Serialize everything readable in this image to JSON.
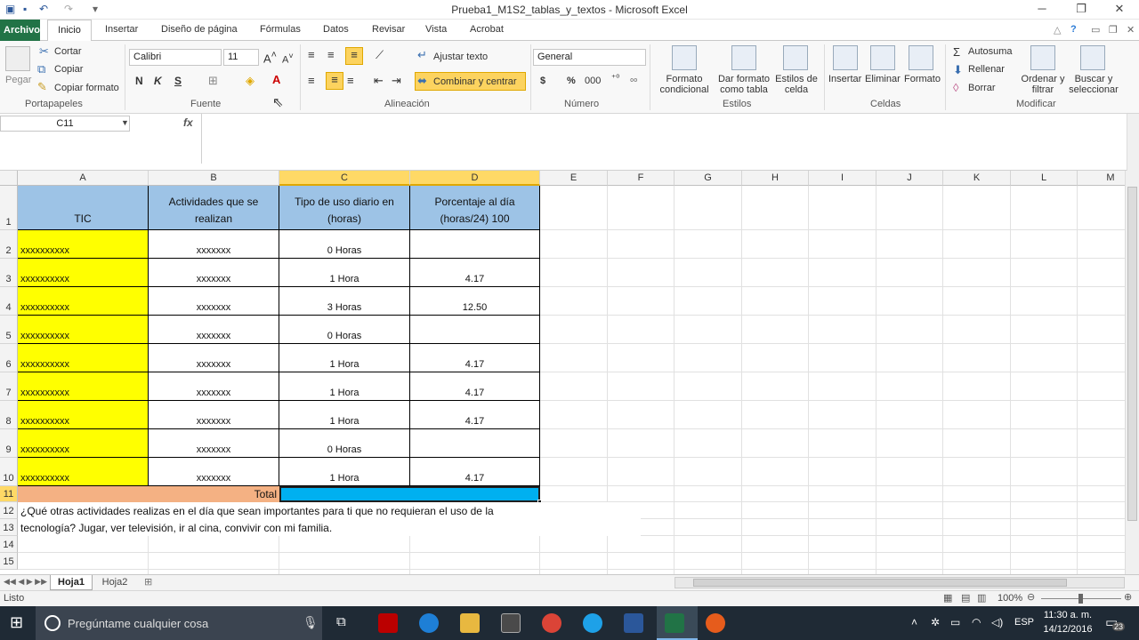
{
  "window": {
    "title": "Prueba1_M1S2_tablas_y_textos  -  Microsoft Excel"
  },
  "ribbon_tabs": [
    "Archivo",
    "Inicio",
    "Insertar",
    "Diseño de página",
    "Fórmulas",
    "Datos",
    "Revisar",
    "Vista",
    "Acrobat"
  ],
  "clipboard": {
    "paste": "Pegar",
    "cut": "Cortar",
    "copy": "Copiar",
    "format_painter": "Copiar formato",
    "label": "Portapapeles"
  },
  "font": {
    "name": "Calibri",
    "size": "11",
    "bold": "N",
    "italic": "K",
    "underline": "S",
    "label": "Fuente"
  },
  "alignment": {
    "wrap": "Ajustar texto",
    "merge": "Combinar y centrar",
    "label": "Alineación"
  },
  "number": {
    "format": "General",
    "currency": "$",
    "percent": "%",
    "thousands": "000",
    "label": "Número"
  },
  "styles": {
    "cond_format": "Formato condicional",
    "format_table": "Dar formato como tabla",
    "cell_styles": "Estilos de celda",
    "label": "Estilos"
  },
  "cells": {
    "insert": "Insertar",
    "delete": "Eliminar",
    "format": "Formato",
    "label": "Celdas"
  },
  "editing": {
    "autosum": "Autosuma",
    "fill": "Rellenar",
    "clear": "Borrar",
    "sort": "Ordenar y filtrar",
    "find": "Buscar y seleccionar",
    "label": "Modificar"
  },
  "formula_bar": {
    "name_box": "C11",
    "fx": "fx",
    "formula": ""
  },
  "columns": [
    "A",
    "B",
    "C",
    "D",
    "E",
    "F",
    "G",
    "H",
    "I",
    "J",
    "K",
    "L",
    "M"
  ],
  "rows": [
    "1",
    "2",
    "3",
    "4",
    "5",
    "6",
    "7",
    "8",
    "9",
    "10",
    "11",
    "12",
    "13",
    "14",
    "15"
  ],
  "table": {
    "headers": [
      "TIC",
      "Actividades que se realizan",
      "Tipo de uso diario en (horas)",
      "Porcentaje al día (horas/24) 100"
    ],
    "data": [
      [
        "xxxxxxxxxx",
        "xxxxxxx",
        "0 Horas",
        ""
      ],
      [
        "xxxxxxxxxx",
        "xxxxxxx",
        "1 Hora",
        "4.17"
      ],
      [
        "xxxxxxxxxx",
        "xxxxxxx",
        "3 Horas",
        "12.50"
      ],
      [
        "xxxxxxxxxx",
        "xxxxxxx",
        "0 Horas",
        ""
      ],
      [
        "xxxxxxxxxx",
        "xxxxxxx",
        "1 Hora",
        "4.17"
      ],
      [
        "xxxxxxxxxx",
        "xxxxxxx",
        "1 Hora",
        "4.17"
      ],
      [
        "xxxxxxxxxx",
        "xxxxxxx",
        "1 Hora",
        "4.17"
      ],
      [
        "xxxxxxxxxx",
        "xxxxxxx",
        "0 Horas",
        ""
      ],
      [
        "xxxxxxxxxx",
        "xxxxxxx",
        "1 Hora",
        "4.17"
      ]
    ],
    "total_label": "Total"
  },
  "text_row12": "¿Qué otras actividades realizas en el día que sean importantes para ti que no requieran el uso de la",
  "text_row13": "tecnología? Jugar, ver televisión, ir al cina, convivir con mi familia.",
  "sheets": [
    "Hoja1",
    "Hoja2"
  ],
  "status": {
    "ready": "Listo",
    "zoom": "100%"
  },
  "taskbar": {
    "search": "Pregúntame cualquier cosa",
    "lang": "ESP",
    "time": "11:30 a. m.",
    "date": "14/12/2016",
    "notif": "23"
  },
  "colors": {
    "header_blue": "#9dc3e6",
    "yellow": "#ffff00",
    "orange": "#f4b183",
    "selection_blue": "#00b0f0",
    "excel_green": "#217346"
  }
}
